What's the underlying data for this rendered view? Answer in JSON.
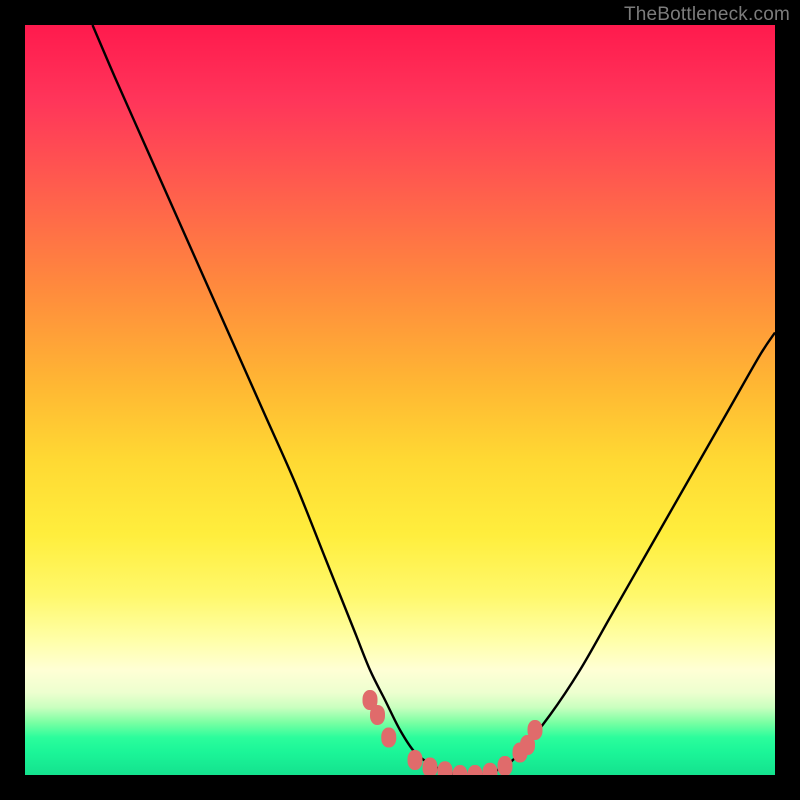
{
  "attribution": "TheBottleneck.com",
  "chart_data": {
    "type": "line",
    "title": "",
    "xlabel": "",
    "ylabel": "",
    "xlim": [
      0,
      100
    ],
    "ylim": [
      0,
      100
    ],
    "grid": false,
    "legend": false,
    "series": [
      {
        "name": "bottleneck-curve",
        "color": "#000000",
        "x": [
          9,
          12,
          16,
          20,
          24,
          28,
          32,
          36,
          40,
          42,
          44,
          46,
          48,
          50,
          52,
          54,
          56,
          58,
          60,
          62,
          64,
          66,
          70,
          74,
          78,
          82,
          86,
          90,
          94,
          98,
          100
        ],
        "y": [
          100,
          93,
          84,
          75,
          66,
          57,
          48,
          39,
          29,
          24,
          19,
          14,
          10,
          6,
          3,
          1.5,
          0.5,
          0,
          0,
          0.3,
          1.2,
          3,
          8,
          14,
          21,
          28,
          35,
          42,
          49,
          56,
          59
        ]
      },
      {
        "name": "highlight-markers",
        "type": "scatter",
        "color": "#e06b6b",
        "x": [
          46,
          47,
          48.5,
          52,
          54,
          56,
          58,
          60,
          62,
          64,
          66,
          67,
          68
        ],
        "y": [
          10,
          8,
          5,
          2,
          1,
          0.5,
          0,
          0,
          0.3,
          1.2,
          3,
          4,
          6
        ]
      }
    ],
    "background_gradient_stops": [
      {
        "offset": 0.0,
        "color": "#ff1a4d"
      },
      {
        "offset": 0.1,
        "color": "#ff355a"
      },
      {
        "offset": 0.22,
        "color": "#ff5e4d"
      },
      {
        "offset": 0.35,
        "color": "#ff8a3d"
      },
      {
        "offset": 0.48,
        "color": "#ffb733"
      },
      {
        "offset": 0.58,
        "color": "#ffd933"
      },
      {
        "offset": 0.68,
        "color": "#ffee3d"
      },
      {
        "offset": 0.76,
        "color": "#fff86b"
      },
      {
        "offset": 0.82,
        "color": "#ffffa8"
      },
      {
        "offset": 0.86,
        "color": "#ffffd5"
      },
      {
        "offset": 0.89,
        "color": "#edffcf"
      },
      {
        "offset": 0.91,
        "color": "#c9ffbf"
      },
      {
        "offset": 0.93,
        "color": "#7affa3"
      },
      {
        "offset": 0.95,
        "color": "#2bfd9c"
      },
      {
        "offset": 0.97,
        "color": "#1bf598"
      },
      {
        "offset": 1.0,
        "color": "#14e28e"
      }
    ]
  }
}
